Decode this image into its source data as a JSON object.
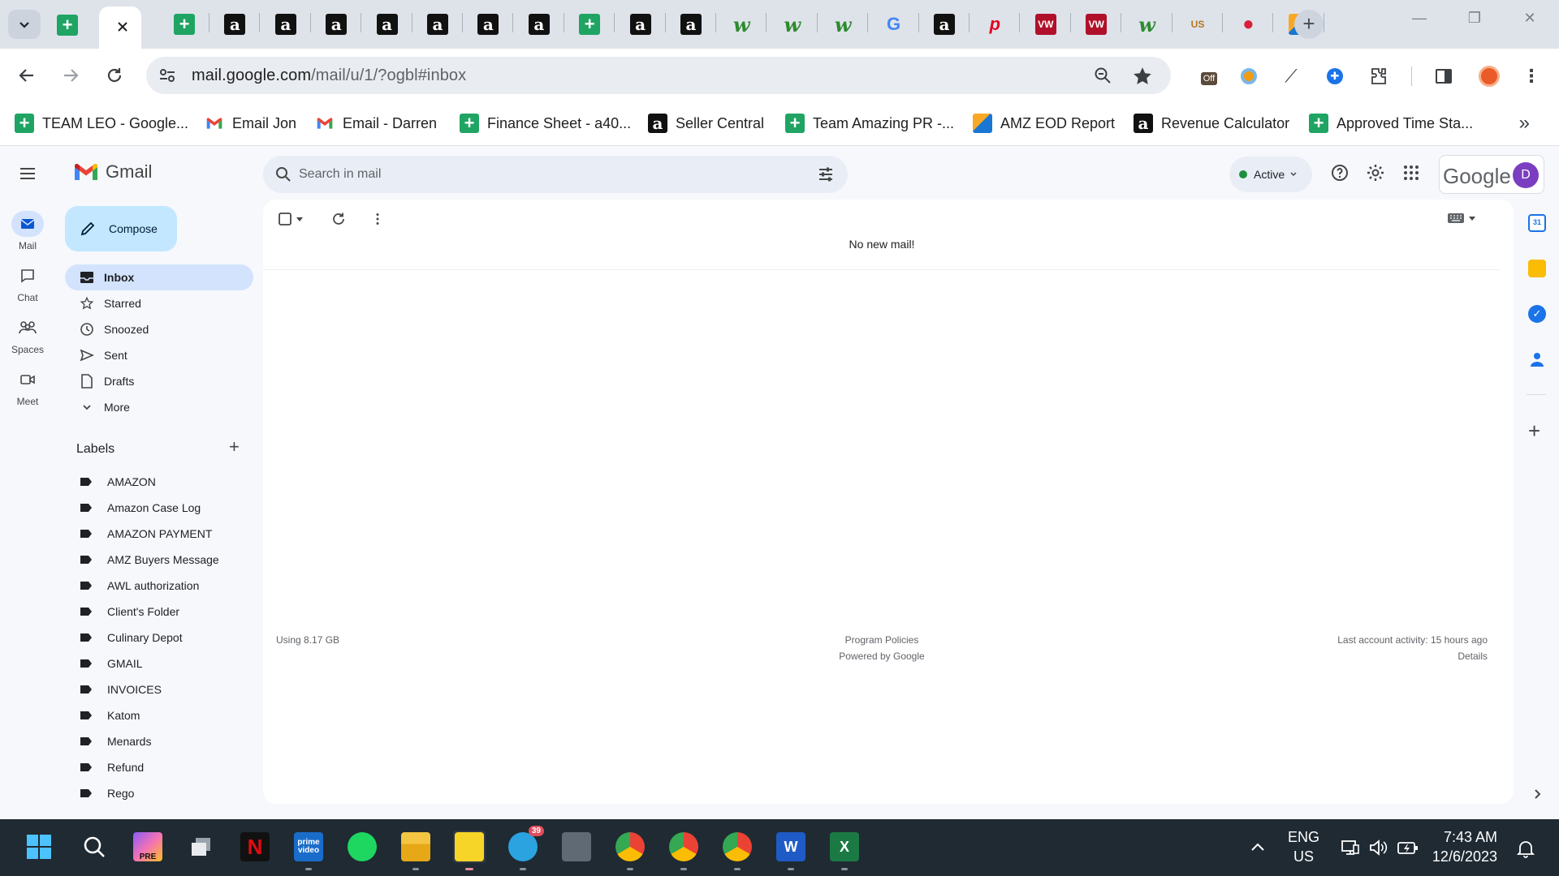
{
  "browser": {
    "address": {
      "host": "mail.google.com",
      "path": "/mail/u/1/?ogbl#inbox"
    },
    "tabs": [
      {
        "icon": "sheets-icon"
      },
      {
        "icon": "sheets-icon"
      },
      {
        "icon": "amazon-icon"
      },
      {
        "icon": "amazon-icon"
      },
      {
        "icon": "amazon-icon"
      },
      {
        "icon": "amazon-icon"
      },
      {
        "icon": "amazon-icon"
      },
      {
        "icon": "amazon-icon"
      },
      {
        "icon": "amazon-icon"
      },
      {
        "icon": "sheets-icon"
      },
      {
        "icon": "amazon-icon"
      },
      {
        "icon": "amazon-icon"
      },
      {
        "icon": "leaf-icon"
      },
      {
        "icon": "leaf-icon"
      },
      {
        "icon": "leaf-icon"
      },
      {
        "icon": "google-icon"
      },
      {
        "icon": "amazon-icon"
      },
      {
        "icon": "pinterest-icon"
      },
      {
        "icon": "vw-icon"
      },
      {
        "icon": "vw-icon"
      },
      {
        "icon": "leaf-icon"
      },
      {
        "icon": "usfoods-icon"
      },
      {
        "icon": "red-c-icon"
      },
      {
        "icon": "multicolor-icon"
      }
    ],
    "bookmarks": [
      {
        "label": "TEAM LEO - Google...",
        "icon": "sheets-icon"
      },
      {
        "label": "Email Jon",
        "icon": "gmail-icon"
      },
      {
        "label": "Email - Darren",
        "icon": "gmail-icon"
      },
      {
        "label": "Finance Sheet - a40...",
        "icon": "sheets-icon"
      },
      {
        "label": "Seller Central",
        "icon": "amazon-icon"
      },
      {
        "label": "Team Amazing PR -...",
        "icon": "sheets-icon"
      },
      {
        "label": "AMZ EOD Report",
        "icon": "multicolor-icon"
      },
      {
        "label": "Revenue Calculator",
        "icon": "amazon-icon"
      },
      {
        "label": "Approved Time Sta...",
        "icon": "sheets-icon"
      }
    ]
  },
  "gmail": {
    "app_name": "Gmail",
    "rail": [
      {
        "label": "Mail",
        "icon": "mail-icon"
      },
      {
        "label": "Chat",
        "icon": "chat-icon"
      },
      {
        "label": "Spaces",
        "icon": "spaces-icon"
      },
      {
        "label": "Meet",
        "icon": "meet-icon"
      }
    ],
    "compose_label": "Compose",
    "search_placeholder": "Search in mail",
    "status": "Active",
    "account_brand": "Google",
    "avatar_initial": "D",
    "nav": [
      {
        "label": "Inbox",
        "icon": "inbox-icon"
      },
      {
        "label": "Starred",
        "icon": "star-icon"
      },
      {
        "label": "Snoozed",
        "icon": "clock-icon"
      },
      {
        "label": "Sent",
        "icon": "send-icon"
      },
      {
        "label": "Drafts",
        "icon": "draft-icon"
      },
      {
        "label": "More",
        "icon": "chevron-down-icon"
      }
    ],
    "labels_title": "Labels",
    "labels": [
      "AMAZON",
      "Amazon Case Log",
      "AMAZON PAYMENT",
      "AMZ Buyers Message",
      "AWL authorization",
      "Client's Folder",
      "Culinary Depot",
      "GMAIL",
      "INVOICES",
      "Katom",
      "Menards",
      "Refund",
      "Rego"
    ],
    "empty_message": "No new mail!",
    "footer": {
      "storage": "Using 8.17 GB",
      "policies": "Program Policies",
      "powered": "Powered by Google",
      "activity": "Last account activity: 15 hours ago",
      "details": "Details"
    }
  },
  "taskbar": {
    "apps": [
      {
        "icon": "windows-start-icon"
      },
      {
        "icon": "search-icon"
      },
      {
        "icon": "copilot-pre-icon",
        "text": "PRE"
      },
      {
        "icon": "task-view-icon"
      },
      {
        "icon": "netflix-icon",
        "text": "N"
      },
      {
        "icon": "prime-video-icon",
        "text": "prime video"
      },
      {
        "icon": "spotify-icon"
      },
      {
        "icon": "file-explorer-icon"
      },
      {
        "icon": "sticky-notes-icon"
      },
      {
        "icon": "telegram-icon",
        "badge": "39"
      },
      {
        "icon": "calculator-icon"
      },
      {
        "icon": "chrome-icon"
      },
      {
        "icon": "chrome-icon"
      },
      {
        "icon": "chrome-icon"
      },
      {
        "icon": "word-icon",
        "text": "W"
      },
      {
        "icon": "excel-icon",
        "text": "X"
      }
    ],
    "lang_line1": "ENG",
    "lang_line2": "US",
    "time": "7:43 AM",
    "date": "12/6/2023"
  }
}
